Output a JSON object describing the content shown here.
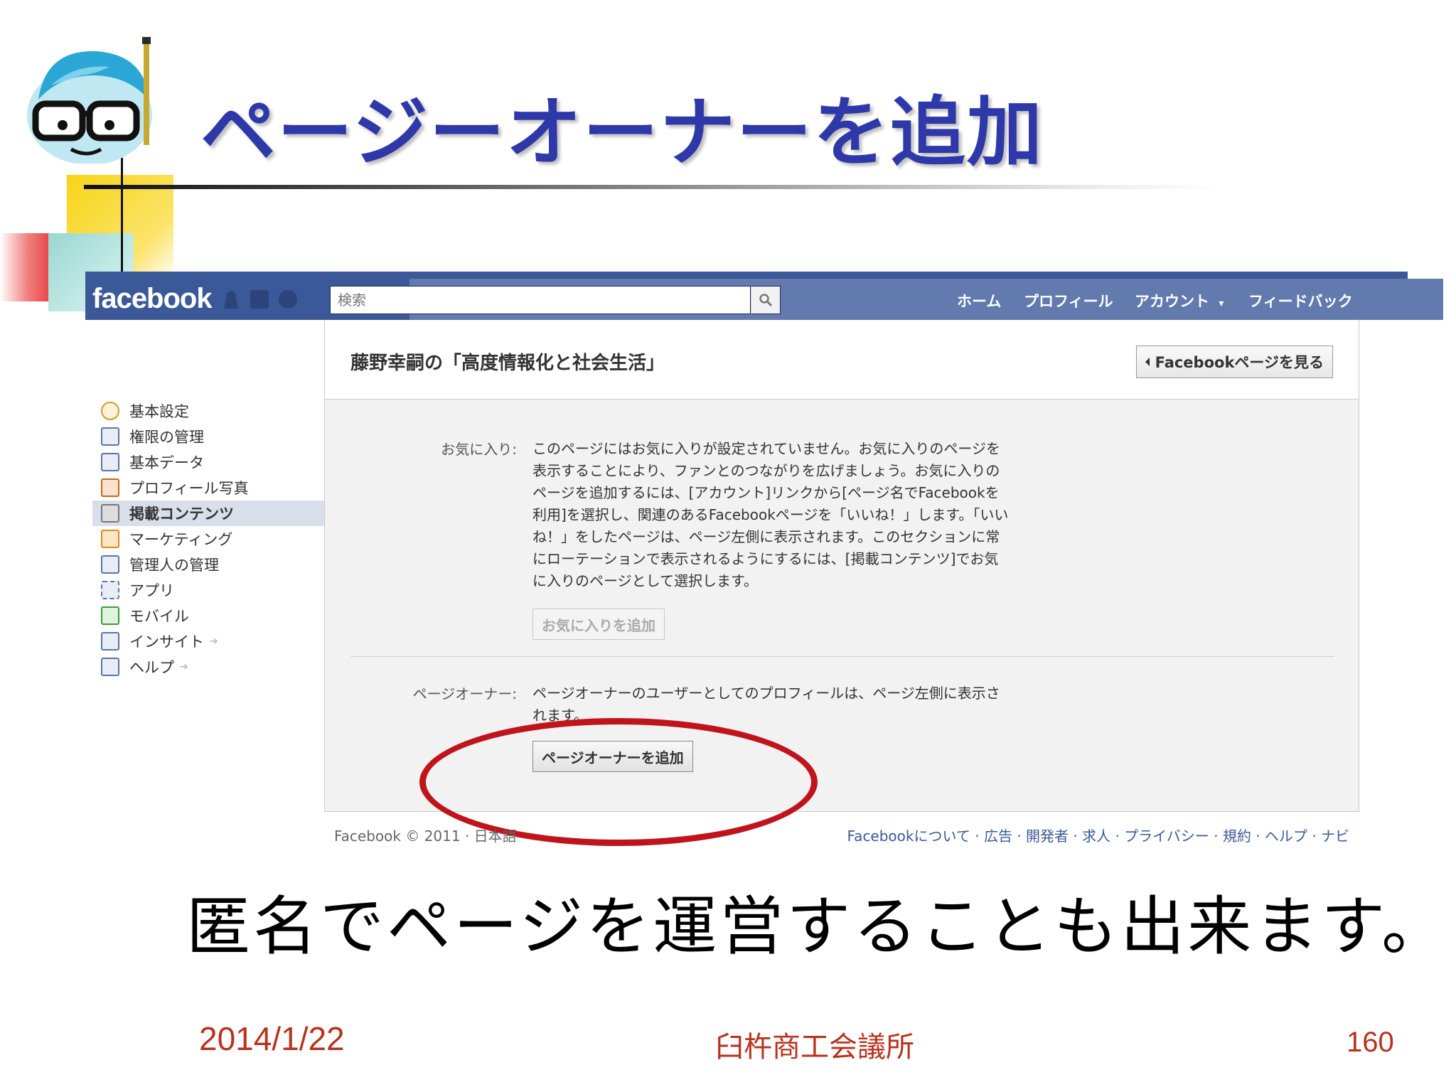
{
  "slide": {
    "title": "ページーオーナーを追加",
    "subtitle": "匿名でページを運営することも出来ます。",
    "date": "2014/1/22",
    "organization": "臼杵商工会議所",
    "page_number": "160"
  },
  "facebook": {
    "logo": "facebook",
    "search_placeholder": "検索",
    "nav": {
      "home": "ホーム",
      "profile": "プロフィール",
      "account": "アカウント",
      "feedback": "フィードバック"
    },
    "page_title": "藤野幸嗣の「高度情報化と社会生活」",
    "view_page_button": "Facebookページを見る",
    "sidebar": [
      {
        "label": "基本設定",
        "icon": "gear-icon"
      },
      {
        "label": "権限の管理",
        "icon": "lock-icon"
      },
      {
        "label": "基本データ",
        "icon": "card-icon"
      },
      {
        "label": "プロフィール写真",
        "icon": "photo-icon"
      },
      {
        "label": "掲載コンテンツ",
        "icon": "megaphone-icon",
        "active": true
      },
      {
        "label": "マーケティング",
        "icon": "megaphone-icon"
      },
      {
        "label": "管理人の管理",
        "icon": "users-icon"
      },
      {
        "label": "アプリ",
        "icon": "apps-icon"
      },
      {
        "label": "モバイル",
        "icon": "mobile-icon"
      },
      {
        "label": "インサイト",
        "icon": "chart-icon"
      },
      {
        "label": "ヘルプ",
        "icon": "help-icon"
      }
    ],
    "favorites": {
      "label": "お気に入り:",
      "text": "このページにはお気に入りが設定されていません。お気に入りのページを表示することにより、ファンとのつながりを広げましょう。お気に入りのページを追加するには、[アカウント]リンクから[ページ名でFacebookを利用]を選択し、関連のあるFacebookページを「いいね！」します。「いいね！」をしたページは、ページ左側に表示されます。このセクションに常にローテーションで表示されるようにするには、[掲載コンテンツ]でお気に入りのページとして選択します。",
      "button": "お気に入りを追加"
    },
    "owner": {
      "label": "ページオーナー:",
      "text": "ページオーナーのユーザーとしてのプロフィールは、ページ左側に表示されます。",
      "button": "ページオーナーを追加"
    },
    "footer_left": "Facebook © 2011 · 日本語",
    "footer_right": "Facebookについて · 広告 · 開発者 · 求人 · プライバシー · 規約 · ヘルプ · ナビ"
  },
  "colors": {
    "title": "#2e38a8",
    "facebook_blue": "#3b5998",
    "highlight_ellipse": "#c0141c",
    "footer_text": "#b8321e"
  }
}
